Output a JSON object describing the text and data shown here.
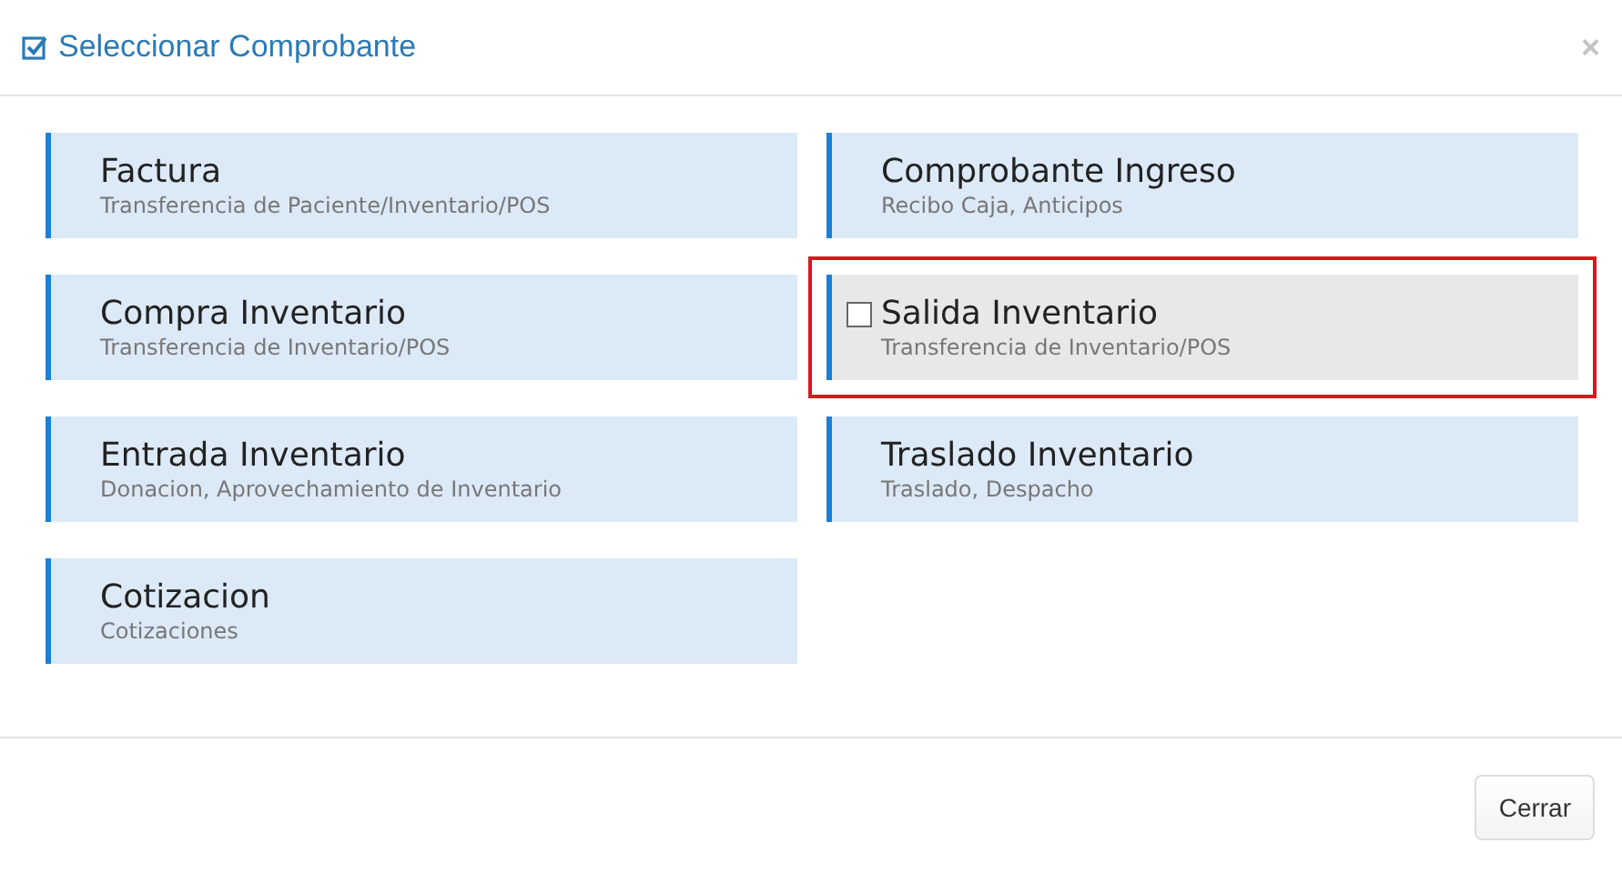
{
  "window": {
    "title": "Seleccionar Comprobante",
    "close": "×"
  },
  "options": [
    {
      "title": "Factura",
      "subtitle": "Transferencia de Paciente/Inventario/POS",
      "selected": false
    },
    {
      "title": "Comprobante Ingreso",
      "subtitle": "Recibo Caja, Anticipos",
      "selected": false
    },
    {
      "title": "Compra Inventario",
      "subtitle": "Transferencia de Inventario/POS",
      "selected": false
    },
    {
      "title": "Salida Inventario",
      "subtitle": "Transferencia de Inventario/POS",
      "selected": true
    },
    {
      "title": "Entrada Inventario",
      "subtitle": "Donacion, Aprovechamiento de Inventario",
      "selected": false
    },
    {
      "title": "Traslado Inventario",
      "subtitle": "Traslado, Despacho",
      "selected": false
    },
    {
      "title": "Cotizacion",
      "subtitle": "Cotizaciones",
      "selected": false
    }
  ],
  "buttons": [
    "Cerrar"
  ]
}
